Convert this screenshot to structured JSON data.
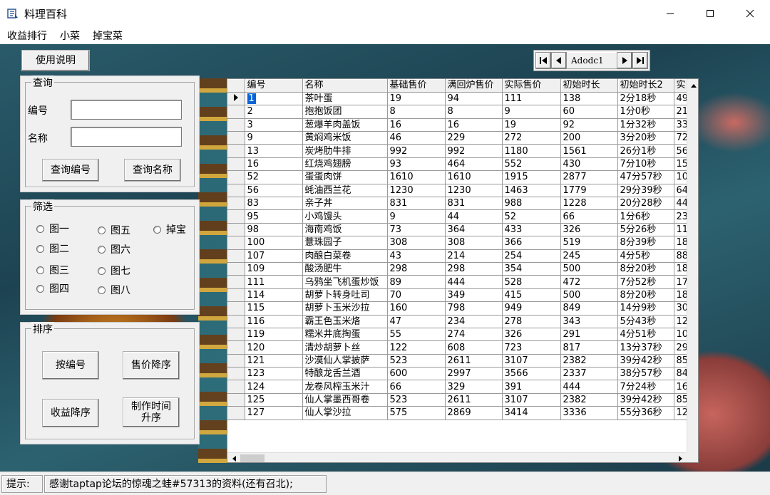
{
  "window": {
    "title": "料理百科"
  },
  "menu": [
    "收益排行",
    "小菜",
    "掉宝菜"
  ],
  "help_button": "使用说明",
  "adodc": {
    "caption": "Adodc1"
  },
  "query": {
    "legend": "查询",
    "code_label": "编号",
    "name_label": "名称",
    "code_value": "",
    "name_value": "",
    "btn_query_code": "查询编号",
    "btn_query_name": "查询名称"
  },
  "filter": {
    "legend": "筛选",
    "options": [
      "图一",
      "图五",
      "掉宝",
      "图二",
      "图六",
      "图三",
      "图七",
      "图四",
      "图八"
    ]
  },
  "sort": {
    "legend": "排序",
    "btn_by_code": "按编号",
    "btn_price_desc": "售价降序",
    "btn_profit_desc": "收益降序",
    "btn_time_asc": "制作时间\n升序"
  },
  "grid": {
    "columns": [
      "编号",
      "名称",
      "基础售价",
      "满回炉售价",
      "实际售价",
      "初始时长",
      "初始时长2",
      "实"
    ],
    "rows": [
      [
        "1",
        "茶叶蛋",
        "19",
        "94",
        "111",
        "138",
        "2分18秒",
        "49"
      ],
      [
        "2",
        "抱抱饭团",
        "8",
        "8",
        "9",
        "60",
        "1分0秒",
        "21"
      ],
      [
        "3",
        "葱爆羊肉盖饭",
        "16",
        "16",
        "19",
        "92",
        "1分32秒",
        "33"
      ],
      [
        "9",
        "黄焖鸡米饭",
        "46",
        "229",
        "272",
        "200",
        "3分20秒",
        "72"
      ],
      [
        "13",
        "炭烤肋牛排",
        "992",
        "992",
        "1180",
        "1561",
        "26分1秒",
        "56"
      ],
      [
        "16",
        "红烧鸡翅膀",
        "93",
        "464",
        "552",
        "430",
        "7分10秒",
        "15"
      ],
      [
        "52",
        "蛋蛋肉饼",
        "1610",
        "1610",
        "1915",
        "2877",
        "47分57秒",
        "10"
      ],
      [
        "56",
        "蚝油西兰花",
        "1230",
        "1230",
        "1463",
        "1779",
        "29分39秒",
        "64"
      ],
      [
        "83",
        "亲子丼",
        "831",
        "831",
        "988",
        "1228",
        "20分28秒",
        "44"
      ],
      [
        "95",
        "小鸡馒头",
        "9",
        "44",
        "52",
        "66",
        "1分6秒",
        "23"
      ],
      [
        "98",
        "海南鸡饭",
        "73",
        "364",
        "433",
        "326",
        "5分26秒",
        "11"
      ],
      [
        "100",
        "薏珠园子",
        "308",
        "308",
        "366",
        "519",
        "8分39秒",
        "18"
      ],
      [
        "107",
        "肉酿白菜卷",
        "43",
        "214",
        "254",
        "245",
        "4分5秒",
        "88"
      ],
      [
        "109",
        "酸汤肥牛",
        "298",
        "298",
        "354",
        "500",
        "8分20秒",
        "18"
      ],
      [
        "111",
        "乌鸦坐飞机蛋炒饭",
        "89",
        "444",
        "528",
        "472",
        "7分52秒",
        "17"
      ],
      [
        "114",
        "胡萝卜转身吐司",
        "70",
        "349",
        "415",
        "500",
        "8分20秒",
        "18"
      ],
      [
        "115",
        "胡萝卜玉米沙拉",
        "160",
        "798",
        "949",
        "849",
        "14分9秒",
        "30"
      ],
      [
        "116",
        "霸王色玉米烙",
        "47",
        "234",
        "278",
        "343",
        "5分43秒",
        "12"
      ],
      [
        "119",
        "糯米井底掏蛋",
        "55",
        "274",
        "326",
        "291",
        "4分51秒",
        "10"
      ],
      [
        "120",
        "清炒胡萝卜丝",
        "122",
        "608",
        "723",
        "817",
        "13分37秒",
        "29"
      ],
      [
        "121",
        "沙漠仙人掌披萨",
        "523",
        "2611",
        "3107",
        "2382",
        "39分42秒",
        "85"
      ],
      [
        "123",
        "特酿龙舌兰酒",
        "600",
        "2997",
        "3566",
        "2337",
        "38分57秒",
        "84"
      ],
      [
        "124",
        "龙卷风榨玉米汁",
        "66",
        "329",
        "391",
        "444",
        "7分24秒",
        "16"
      ],
      [
        "125",
        "仙人掌墨西哥卷",
        "523",
        "2611",
        "3107",
        "2382",
        "39分42秒",
        "85"
      ],
      [
        "127",
        "仙人掌沙拉",
        "575",
        "2869",
        "3414",
        "3336",
        "55分36秒",
        "12"
      ]
    ]
  },
  "status": {
    "label": "提示:",
    "text": "感谢taptap论坛的惊魂之蛙#57313的资料(还有召北);"
  }
}
